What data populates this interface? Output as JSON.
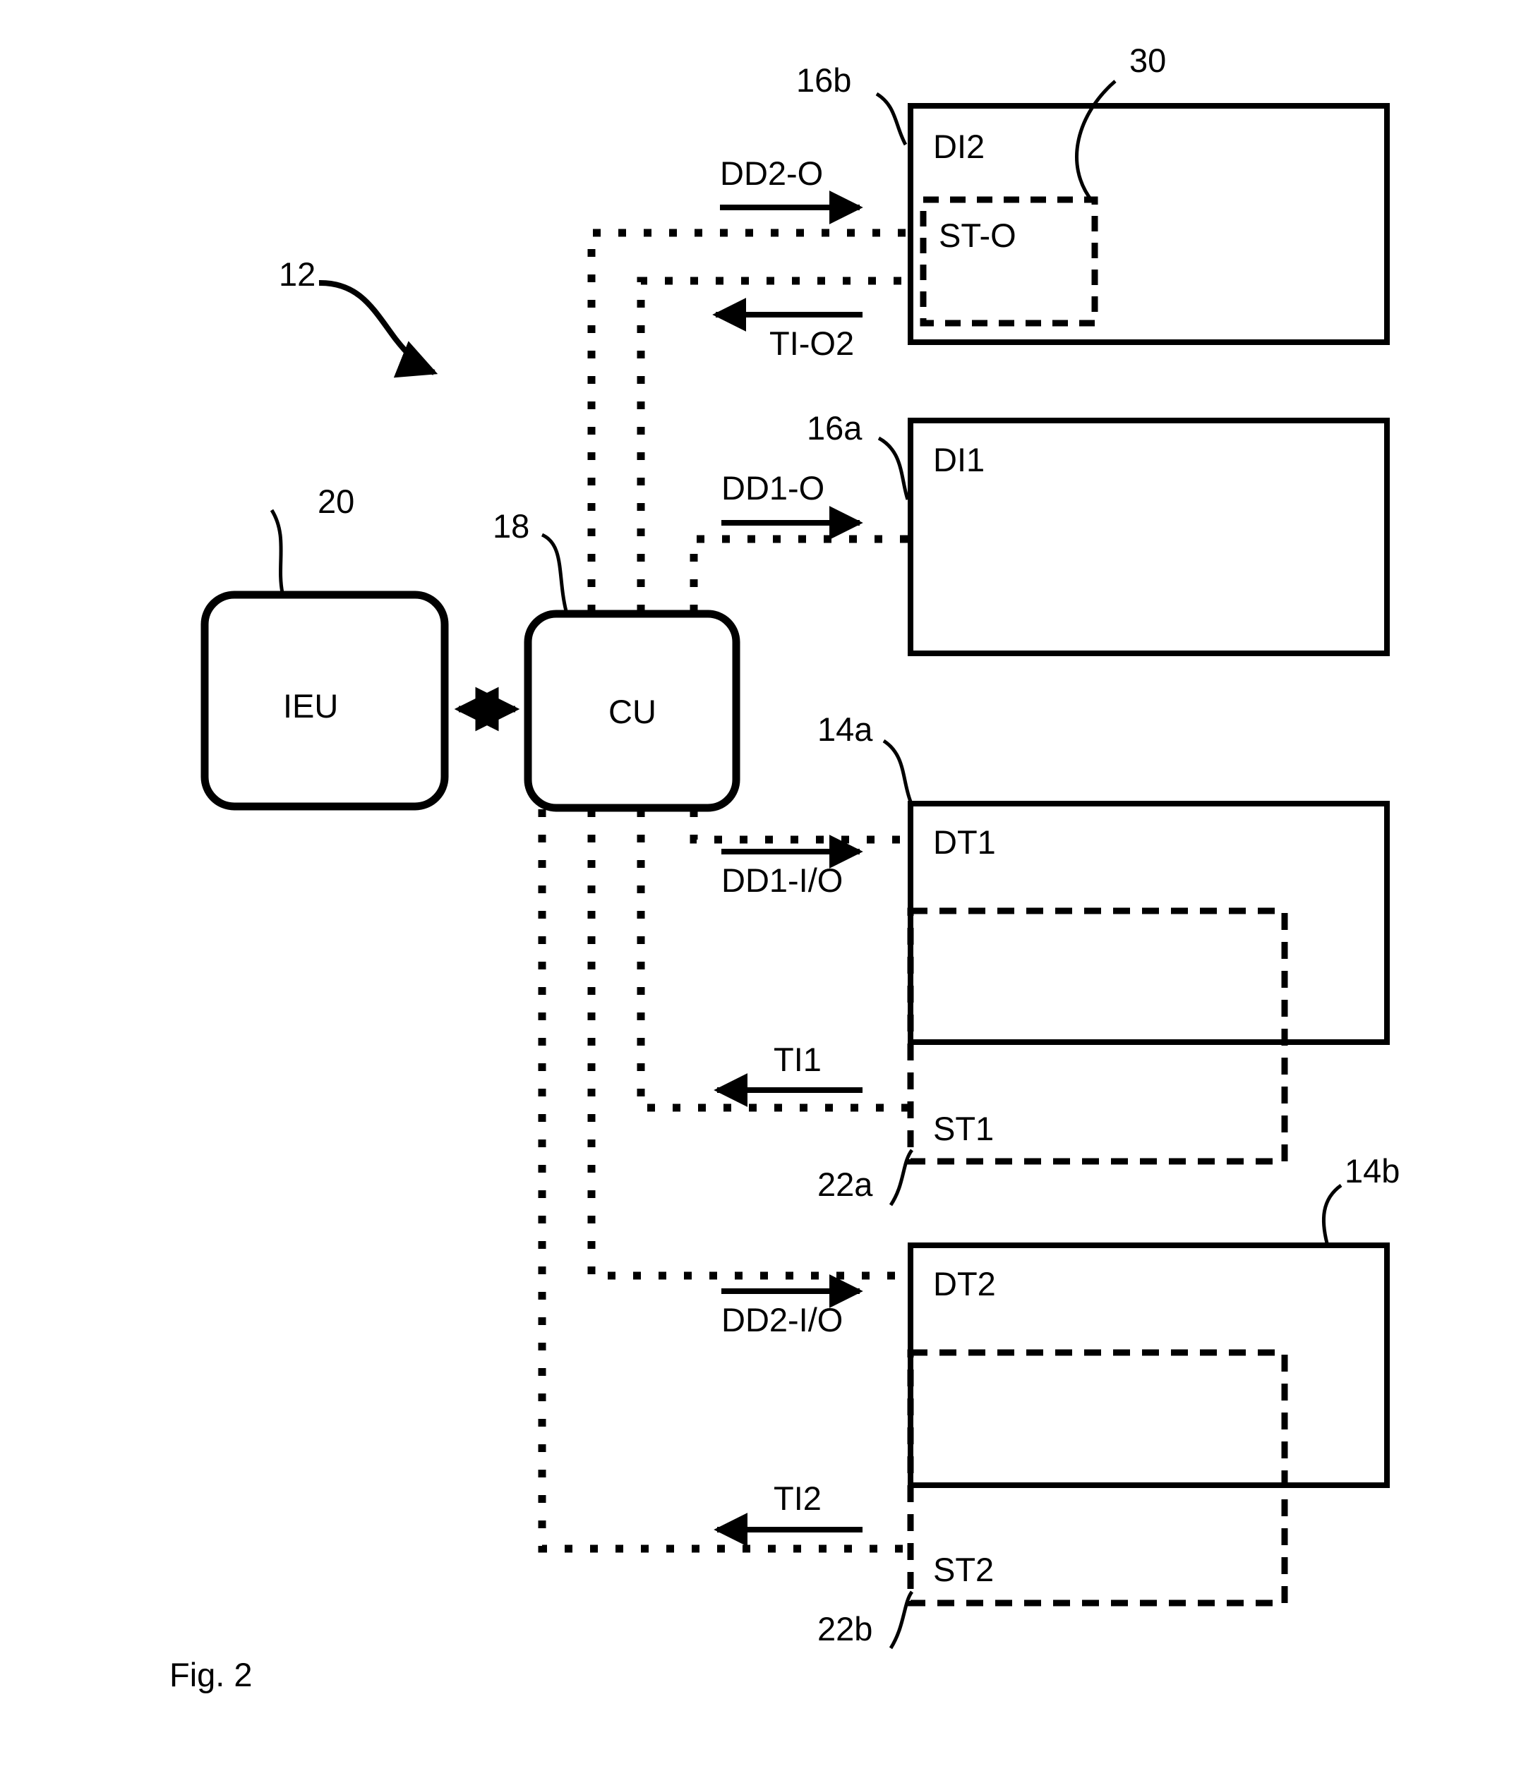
{
  "figure": {
    "caption": "Fig. 2",
    "overall_ref": "12"
  },
  "blocks": [
    {
      "id": "di2",
      "label": "DI2",
      "ref": "16b",
      "style": "solid-rect"
    },
    {
      "id": "sto",
      "label": "ST-O",
      "ref": "30",
      "style": "dashed-rect"
    },
    {
      "id": "di1",
      "label": "DI1",
      "ref": "16a",
      "style": "solid-rect"
    },
    {
      "id": "ieu",
      "label": "IEU",
      "ref": "20",
      "style": "rounded-rect"
    },
    {
      "id": "cu",
      "label": "CU",
      "ref": "18",
      "style": "rounded-rect"
    },
    {
      "id": "dt1",
      "label": "DT1",
      "ref": "14a",
      "style": "solid-rect"
    },
    {
      "id": "st1",
      "label": "ST1",
      "ref": "22a",
      "style": "dashed-rect"
    },
    {
      "id": "dt2",
      "label": "DT2",
      "ref": "14b",
      "style": "solid-rect"
    },
    {
      "id": "st2",
      "label": "ST2",
      "ref": "22b",
      "style": "dashed-rect"
    }
  ],
  "signals": [
    {
      "id": "dd2o",
      "label": "DD2-O",
      "direction": "right"
    },
    {
      "id": "tio2",
      "label": "TI-O2",
      "direction": "left"
    },
    {
      "id": "dd1o",
      "label": "DD1-O",
      "direction": "right"
    },
    {
      "id": "dd1io",
      "label": "DD1-I/O",
      "direction": "right"
    },
    {
      "id": "ti1",
      "label": "TI1",
      "direction": "left"
    },
    {
      "id": "dd2io",
      "label": "DD2-I/O",
      "direction": "right"
    },
    {
      "id": "ti2",
      "label": "TI2",
      "direction": "left"
    }
  ],
  "link_ieu_cu": {
    "direction": "bidirectional"
  },
  "colors": {
    "ink": "#000000",
    "paper": "#ffffff"
  }
}
